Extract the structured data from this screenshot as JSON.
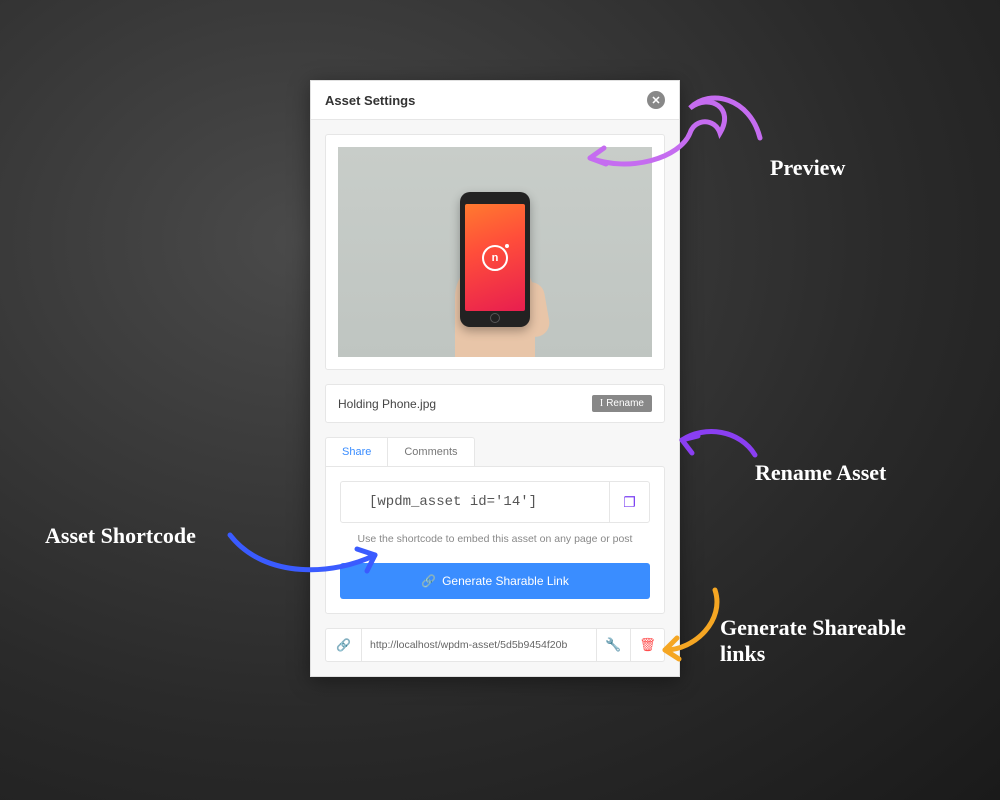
{
  "header": {
    "title": "Asset Settings"
  },
  "file": {
    "name": "Holding Phone.jpg",
    "rename_label": "Rename"
  },
  "tabs": {
    "share": "Share",
    "comments": "Comments"
  },
  "share": {
    "shortcode": "[wpdm_asset id='14']",
    "helper": "Use the shortcode to embed this asset on any page or post",
    "generate_label": "Generate Sharable Link",
    "link_url": "http://localhost/wpdm-asset/5d5b9454f20b"
  },
  "annotations": {
    "preview": "Preview",
    "rename": "Rename Asset",
    "shortcode": "Asset Shortcode",
    "generate": "Generate Shareable links"
  },
  "icons": {
    "close": "✕",
    "cursor": "I",
    "copy": "❐",
    "link": "🔗",
    "wrench": "🔧",
    "trash": "🗑",
    "phone_logo": "n"
  }
}
